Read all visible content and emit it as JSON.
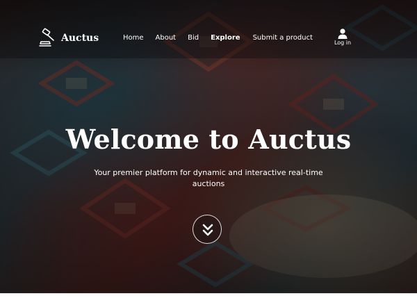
{
  "brand": {
    "name": "Auctus",
    "icon": "gavel-icon"
  },
  "nav": {
    "items": [
      {
        "label": "Home"
      },
      {
        "label": "About"
      },
      {
        "label": "Bid"
      },
      {
        "label": "Explore",
        "active": true
      },
      {
        "label": "Submit a product"
      }
    ]
  },
  "login": {
    "label": "Log in",
    "icon": "user-icon"
  },
  "hero": {
    "title": "Welcome to Auctus",
    "subtitle": "Your premier platform for dynamic and interactive real-time auctions",
    "scroll_icon": "double-chevron-down-icon"
  },
  "colors": {
    "text": "#ffffff",
    "overlay": "#000000"
  }
}
